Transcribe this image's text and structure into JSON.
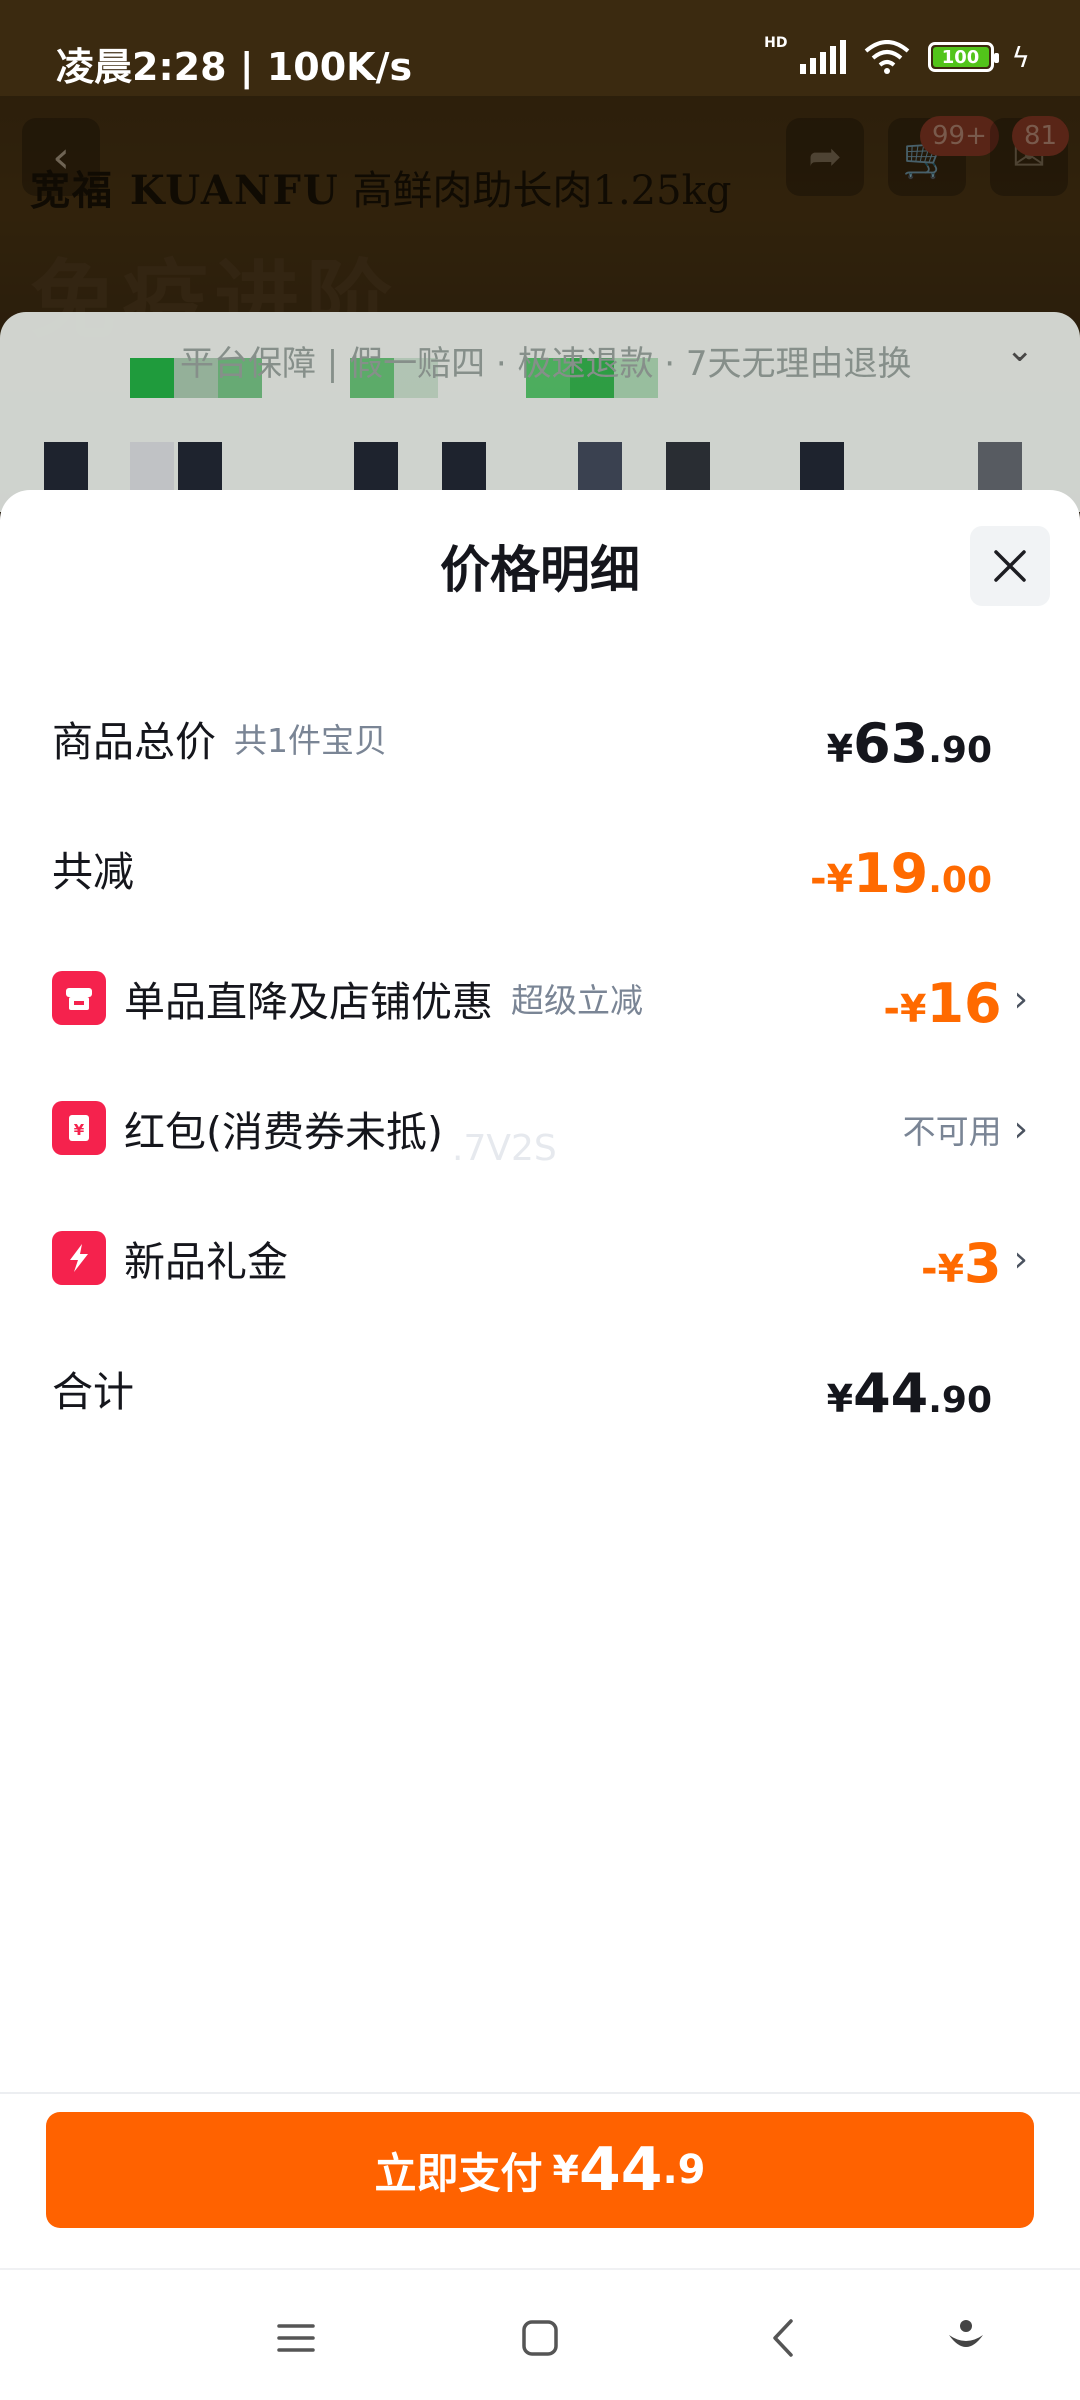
{
  "status_bar": {
    "time": "凌晨2:28 | 100K/s",
    "network_type": "HD",
    "battery": "100"
  },
  "background_app": {
    "back_icon": "chevron-left-icon",
    "brand": "宽福 KUANFU",
    "product_title": "高鲜肉助长肉1.25kg",
    "share_icon": "share-icon",
    "cart_badge": "99+",
    "message_badge": "81",
    "slogan": "免疫进阶",
    "guarantee_text": "平台保障 | 假一赔四 · 极速退款 · 7天无理由退换"
  },
  "sheet": {
    "title": "价格明细",
    "close_icon": "close-icon",
    "rows": [
      {
        "label": "商品总价",
        "sub": "共1件宝贝",
        "price": {
          "currency": "¥",
          "integer": "63",
          "decimal": ".90"
        }
      },
      {
        "label": "共减",
        "price": {
          "sign": "-",
          "currency": "¥",
          "integer": "19",
          "decimal": ".00"
        }
      },
      {
        "icon": "store-icon",
        "label": "单品直降及店铺优惠",
        "sub": "超级立减",
        "price": {
          "sign": "-",
          "currency": "¥",
          "integer": "16"
        }
      },
      {
        "icon": "red-packet-icon",
        "label": "红包(消费券未抵)",
        "status": "不可用"
      },
      {
        "icon": "lightning-gift-icon",
        "label": "新品礼金",
        "price": {
          "sign": "-",
          "currency": "¥",
          "integer": "3"
        }
      },
      {
        "label": "合计",
        "price": {
          "currency": "¥",
          "integer": "44",
          "decimal": ".90"
        }
      }
    ],
    "watermark": ".7V2S"
  },
  "pay_button": {
    "label": "立即支付",
    "currency": "¥",
    "integer": "44",
    "decimal": ".9"
  },
  "nav_bar": {
    "menu_icon": "menu-icon",
    "home_icon": "home-square-icon",
    "back_icon": "back-triangle-icon",
    "assist_icon": "assistant-icon"
  },
  "colors": {
    "accent_orange": "#ff6200",
    "discount_orange": "#ff6a00",
    "icon_red": "#f5224d",
    "text_dark": "#15161c",
    "text_gray": "#7a8595"
  }
}
